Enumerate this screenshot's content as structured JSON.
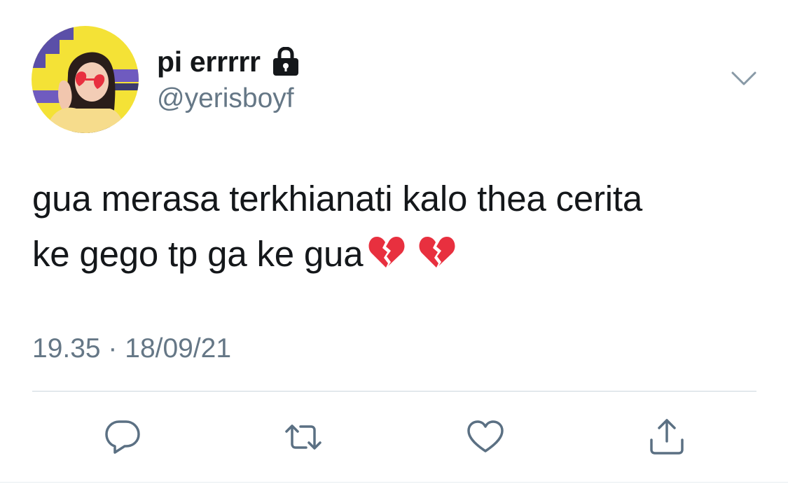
{
  "user": {
    "display_name": "pi errrrr",
    "handle": "@yerisboyf"
  },
  "tweet": {
    "line1": "gua merasa terkhianati kalo thea cerita",
    "line2": "ke gego tp ga ke gua",
    "emojis": [
      "broken-heart-icon",
      "broken-heart-icon"
    ],
    "timestamp": "19.35 · 18/09/21"
  },
  "actions": [
    "reply-icon",
    "retweet-icon",
    "like-icon",
    "share-icon"
  ],
  "colors": {
    "text": "#14171a",
    "secondary": "#657786",
    "icon": "#5b7083",
    "divider": "#ccd6dd",
    "emoji": "#e8303f",
    "avatar_bg": "#f4e236"
  }
}
